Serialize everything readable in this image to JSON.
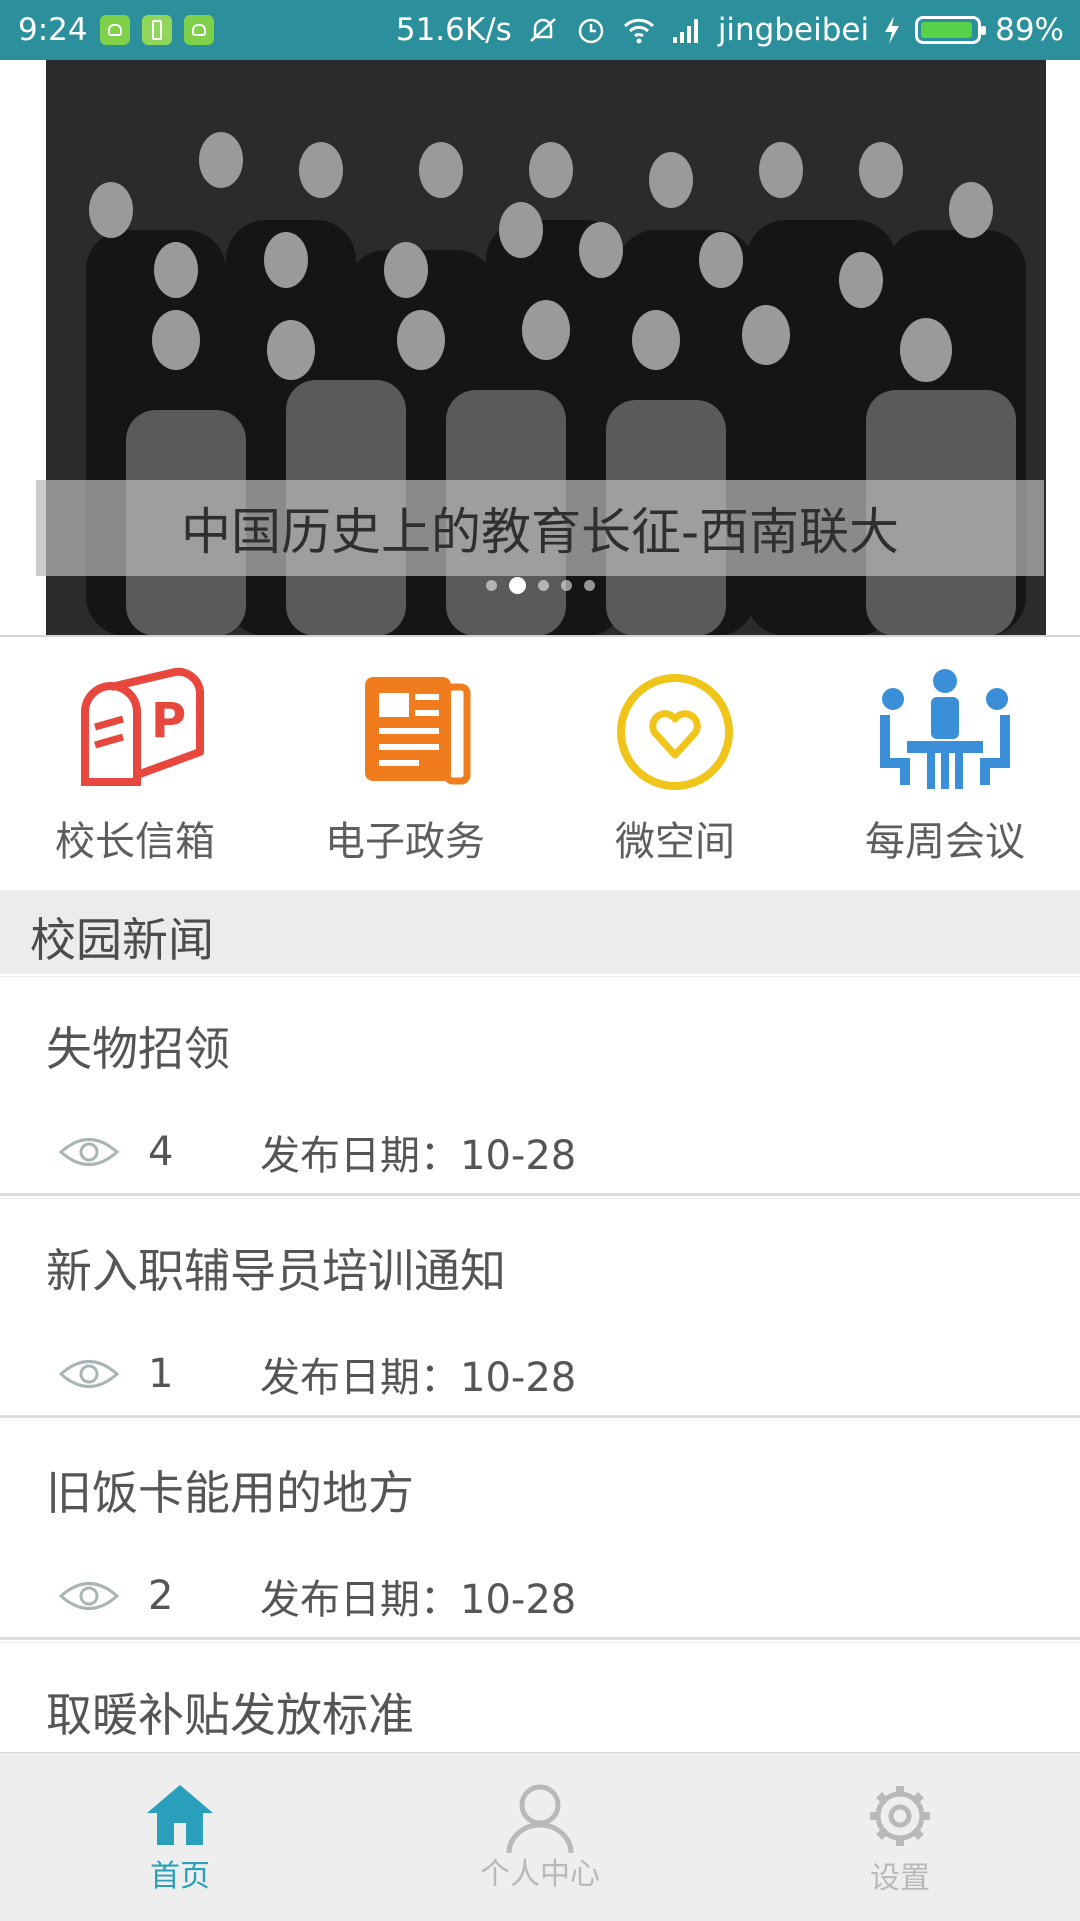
{
  "status_bar": {
    "time": "9:24",
    "speed": "51.6K/s",
    "carrier": "jingbeibei",
    "battery": "89%"
  },
  "banner": {
    "caption": "中国历史上的教育长征-西南联大",
    "slide_count": 5,
    "active_slide": 2
  },
  "quick_menu": {
    "items": [
      {
        "label": "校长信箱",
        "icon": "mailbox-icon",
        "color": "#e8473e"
      },
      {
        "label": "电子政务",
        "icon": "newspaper-icon",
        "color": "#f07c1e"
      },
      {
        "label": "微空间",
        "icon": "heart-circle-icon",
        "color": "#f0c419"
      },
      {
        "label": "每周会议",
        "icon": "meeting-icon",
        "color": "#3a8fd8"
      }
    ]
  },
  "section": {
    "title": "校园新闻"
  },
  "news": [
    {
      "title": "失物招领",
      "views": "4",
      "date": "发布日期：10-28"
    },
    {
      "title": "新入职辅导员培训通知",
      "views": "1",
      "date": "发布日期：10-28"
    },
    {
      "title": "旧饭卡能用的地方",
      "views": "2",
      "date": "发布日期：10-28"
    },
    {
      "title": "取暖补贴发放标准",
      "views": "",
      "date": ""
    }
  ],
  "tabbar": {
    "tabs": [
      {
        "label": "首页",
        "icon": "home-icon",
        "active": true
      },
      {
        "label": "个人中心",
        "icon": "person-icon",
        "active": false
      },
      {
        "label": "设置",
        "icon": "gear-icon",
        "active": false
      }
    ],
    "active_color": "#2aa0bd",
    "inactive_color": "#b9b9b9"
  }
}
